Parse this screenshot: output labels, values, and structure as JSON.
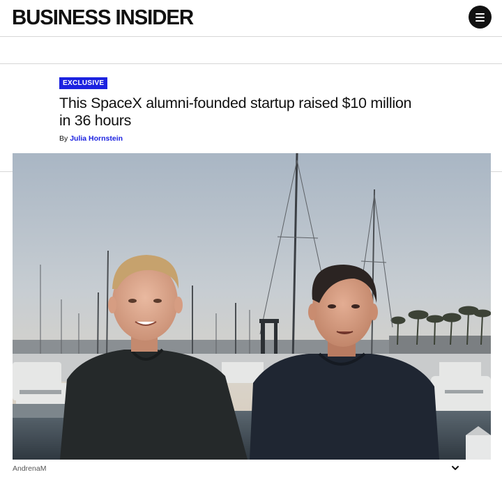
{
  "header": {
    "logo": "BUSINESS INSIDER",
    "menu_icon": "hamburger-menu-icon"
  },
  "article": {
    "badge": "EXCLUSIVE",
    "headline": "This SpaceX alumni-founded startup raised $10 million in 36 hours",
    "byline_prefix": "By",
    "author": "Julia Hornstein",
    "image_caption": "AndrenaM",
    "caption_toggle_icon": "chevron-down-icon"
  },
  "colors": {
    "accent": "#1c22e0",
    "text": "#111111",
    "divider": "#d6d6d6"
  }
}
